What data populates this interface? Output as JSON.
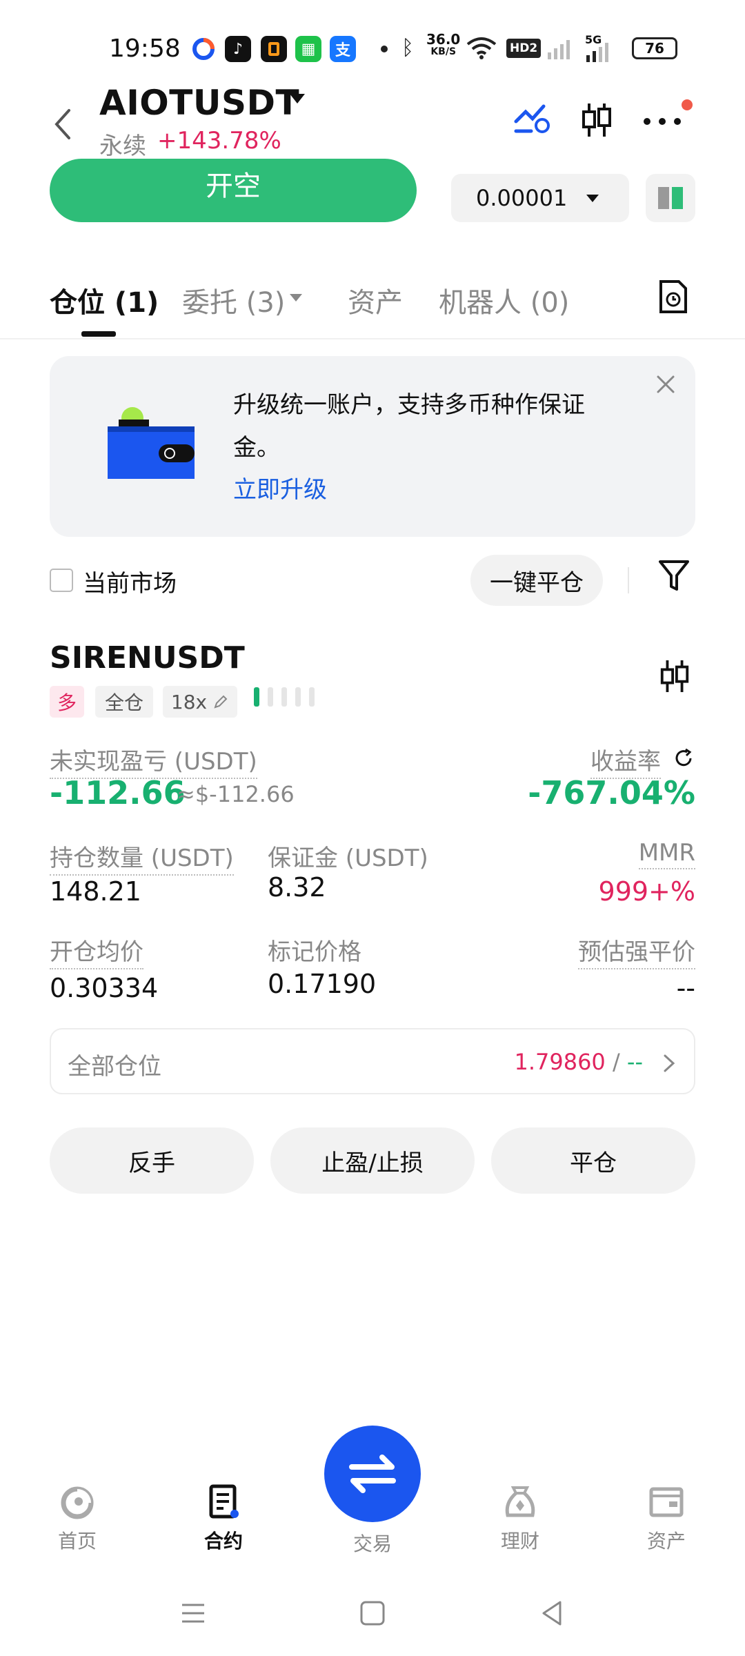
{
  "status_bar": {
    "time": "19:58",
    "net_speed_value": "36.0",
    "net_speed_unit": "KB/S",
    "hd_label": "HD2",
    "signal_label": "5G",
    "battery": "76"
  },
  "header": {
    "pair": "AIOTUSDT",
    "contract_type": "永续",
    "change": "+143.78%"
  },
  "action_row": {
    "short_label": "开空",
    "price_step": "0.00001"
  },
  "tabs": [
    {
      "label": "仓位 (1)"
    },
    {
      "label": "委托 (3)"
    },
    {
      "label": "资产"
    },
    {
      "label": "机器人 (0)"
    }
  ],
  "banner": {
    "text": "升级统一账户，支持多币种作保证金。",
    "link": "立即升级"
  },
  "filter": {
    "current_market": "当前市场",
    "close_all": "一键平仓"
  },
  "position": {
    "symbol": "SIRENUSDT",
    "side": "多",
    "margin_mode": "全仓",
    "leverage": "18x",
    "pnl_label": "未实现盈亏 (USDT)",
    "pnl_value": "-112.66",
    "pnl_usd": "≈$-112.66",
    "roe_label": "收益率",
    "roe_value": "-767.04%",
    "size_label": "持仓数量 (USDT)",
    "size_value": "148.21",
    "margin_label": "保证金 (USDT)",
    "margin_value": "8.32",
    "mmr_label": "MMR",
    "mmr_value": "999+%",
    "entry_label": "开仓均价",
    "entry_value": "0.30334",
    "mark_label": "标记价格",
    "mark_value": "0.17190",
    "liq_label": "预估强平价",
    "liq_value": "--"
  },
  "all_positions": {
    "label": "全部仓位",
    "long_value": "1.79860",
    "separator": "/",
    "short_value": "--"
  },
  "actions": {
    "reverse": "反手",
    "tpsl": "止盈/止损",
    "close": "平仓"
  },
  "bottom_nav": {
    "home": "首页",
    "contract": "合约",
    "trade": "交易",
    "finance": "理财",
    "assets": "资产"
  },
  "colors": {
    "green": "#2ebd78",
    "red": "#e0245e",
    "blue": "#1b56ef",
    "link": "#1a5fe0"
  }
}
